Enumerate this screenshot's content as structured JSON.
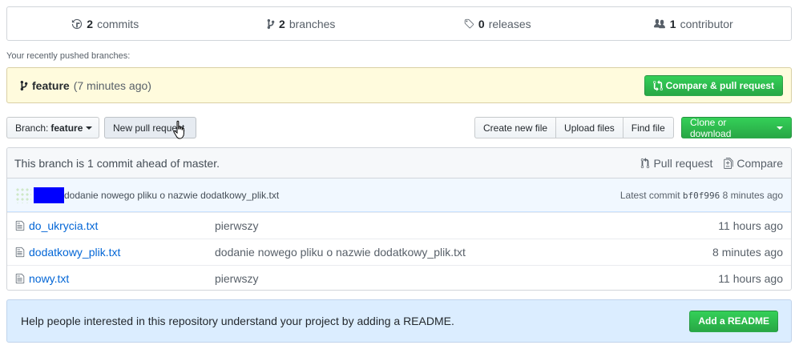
{
  "summary": {
    "commits": {
      "count": "2",
      "label": "commits"
    },
    "branches": {
      "count": "2",
      "label": "branches"
    },
    "releases": {
      "count": "0",
      "label": "releases"
    },
    "contributors": {
      "count": "1",
      "label": "contributor"
    }
  },
  "recent": {
    "label": "Your recently pushed branches:",
    "branch": "feature",
    "age": "(7 minutes ago)",
    "compare_label": "Compare & pull request"
  },
  "toolbar": {
    "branch_prefix": "Branch:",
    "branch_name": "feature",
    "new_pr": "New pull request",
    "create_file": "Create new file",
    "upload": "Upload files",
    "find": "Find file",
    "clone": "Clone or download"
  },
  "ahead": {
    "text": "This branch is 1 commit ahead of master.",
    "pull_request": "Pull request",
    "compare": "Compare"
  },
  "commit": {
    "message": "dodanie nowego pliku o nazwie dodatkowy_plik.txt",
    "latest_label": "Latest commit",
    "sha": "bf0f996",
    "age": "8 minutes ago"
  },
  "files": [
    {
      "name": "do_ukrycia.txt",
      "message": "pierwszy",
      "age": "11 hours ago"
    },
    {
      "name": "dodatkowy_plik.txt",
      "message": "dodanie nowego pliku o nazwie dodatkowy_plik.txt",
      "age": "8 minutes ago"
    },
    {
      "name": "nowy.txt",
      "message": "pierwszy",
      "age": "11 hours ago"
    }
  ],
  "readme": {
    "text": "Help people interested in this repository understand your project by adding a README.",
    "button": "Add a README"
  }
}
